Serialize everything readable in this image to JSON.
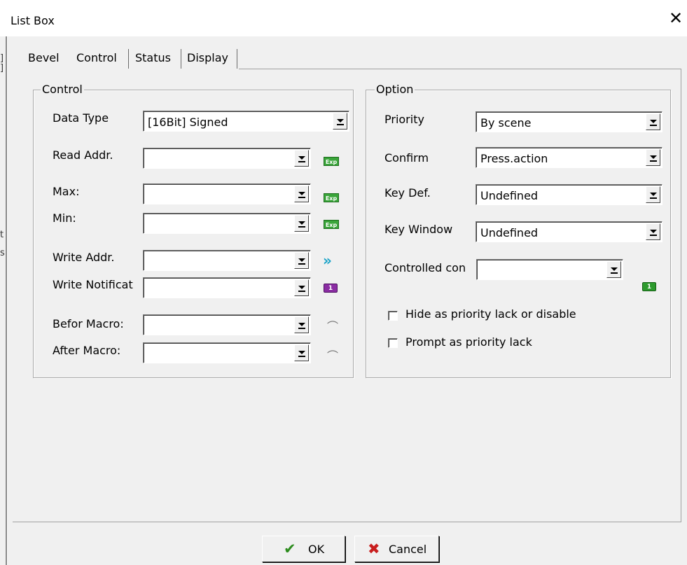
{
  "window": {
    "title": "List Box",
    "close_glyph": "✕"
  },
  "left_edge_marks": [
    "]",
    "]",
    "t",
    "s"
  ],
  "tabs": [
    {
      "label": "Bevel"
    },
    {
      "label": "Control"
    },
    {
      "label": "Status"
    },
    {
      "label": "Display"
    }
  ],
  "control_group": {
    "legend": "Control",
    "fields": {
      "data_type": {
        "label": "Data Type",
        "value": "[16Bit] Signed"
      },
      "read_addr": {
        "label": "Read Addr.",
        "value": "",
        "icon": "exp-icon",
        "icon_text": "Exp"
      },
      "max": {
        "label": "Max:",
        "value": "",
        "icon": "exp-icon",
        "icon_text": "Exp"
      },
      "min": {
        "label": "Min:",
        "value": "",
        "icon": "exp-icon",
        "icon_text": "Exp"
      },
      "write_addr": {
        "label": "Write Addr.",
        "value": "",
        "icon": "double-chevron-icon",
        "icon_text": "»"
      },
      "write_notification": {
        "label": "Write Notificat",
        "value": "",
        "icon": "purple-one-icon",
        "icon_text": "1"
      },
      "before_macro": {
        "label": "Befor Macro:",
        "value": "",
        "icon": "macro-icon",
        "icon_text": "⌒"
      },
      "after_macro": {
        "label": "After Macro:",
        "value": "",
        "icon": "macro-icon",
        "icon_text": "⌒"
      }
    }
  },
  "option_group": {
    "legend": "Option",
    "fields": {
      "priority": {
        "label": "Priority",
        "value": "By scene"
      },
      "confirm": {
        "label": "Confirm",
        "value": "Press.action"
      },
      "key_def": {
        "label": "Key Def.",
        "value": "Undefined"
      },
      "key_window": {
        "label": "Key Window",
        "value": "Undefined"
      },
      "controlled_con": {
        "label": "Controlled con",
        "value": "",
        "icon": "green-one-icon",
        "icon_text": "1"
      }
    },
    "checkboxes": [
      {
        "label": "Hide as priority lack or disable",
        "checked": false
      },
      {
        "label": "Prompt as priority lack",
        "checked": false
      }
    ]
  },
  "buttons": {
    "ok": {
      "label": "OK",
      "icon": "checkmark-icon",
      "glyph": "✔"
    },
    "cancel": {
      "label": "Cancel",
      "icon": "x-icon",
      "glyph": "✖"
    }
  },
  "colors": {
    "ok_icon": "#2d8c1e",
    "cancel_icon": "#c81e1e",
    "exp_badge": "#3aa53a",
    "chevron": "#1aa3c8",
    "notify_badge": "#8b2da3"
  }
}
